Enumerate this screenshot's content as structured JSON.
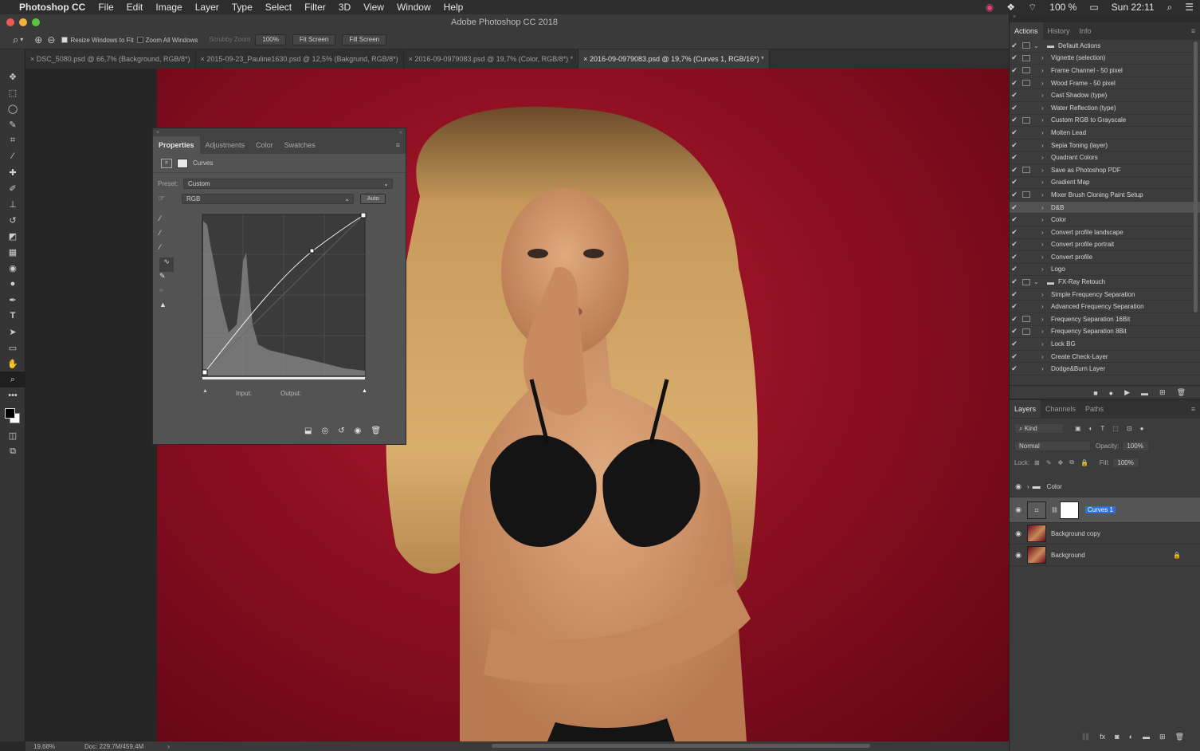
{
  "menubar": {
    "app_name": "Photoshop CC",
    "items": [
      "File",
      "Edit",
      "Image",
      "Layer",
      "Type",
      "Select",
      "Filter",
      "3D",
      "View",
      "Window",
      "Help"
    ],
    "battery": "100 %",
    "clock": "Sun 22:11"
  },
  "window": {
    "title": "Adobe Photoshop CC 2018"
  },
  "options": {
    "resize_windows": "Resize Windows to Fit",
    "zoom_all": "Zoom All Windows",
    "scrubby_zoom": "Scrubby Zoom",
    "zoom_value": "100%",
    "fit_screen": "Fit Screen",
    "fill_screen": "Fill Screen"
  },
  "tabs": [
    "DSC_5080.psd @ 66,7% (Background, RGB/8*)",
    "2015-09-23_Pauline1630.psd @ 12,5% (Bakgrund, RGB/8*)",
    "2016-09-0979083.psd @ 19,7% (Color, RGB/8*) *",
    "2016-09-0979083.psd @ 19,7% (Curves 1, RGB/16*) *"
  ],
  "status": {
    "zoom": "19,68%",
    "doc": "Doc: 229,7M/459,4M"
  },
  "properties": {
    "tabs": [
      "Properties",
      "Adjustments",
      "Color",
      "Swatches"
    ],
    "header": "Curves",
    "preset_label": "Preset:",
    "preset_value": "Custom",
    "channel": "RGB",
    "auto": "Auto",
    "input_label": "Input:",
    "output_label": "Output:"
  },
  "actions": {
    "tabs": [
      "Actions",
      "History",
      "Info"
    ],
    "rows": [
      {
        "label": "Default Actions",
        "folder": true,
        "dialog": true
      },
      {
        "label": "Vignette (selection)",
        "dialog": true
      },
      {
        "label": "Frame Channel - 50 pixel",
        "dialog": true
      },
      {
        "label": "Wood Frame - 50 pixel",
        "dialog": true
      },
      {
        "label": "Cast Shadow (type)",
        "dialog": false
      },
      {
        "label": "Water Reflection (type)",
        "dialog": false
      },
      {
        "label": "Custom RGB to Grayscale",
        "dialog": true
      },
      {
        "label": "Molten Lead",
        "dialog": false
      },
      {
        "label": "Sepia Toning (layer)",
        "dialog": false
      },
      {
        "label": "Quadrant Colors",
        "dialog": false
      },
      {
        "label": "Save as Photoshop PDF",
        "dialog": true
      },
      {
        "label": "Gradient Map",
        "dialog": false
      },
      {
        "label": "Mixer Brush Cloning Paint Setup",
        "dialog": true
      },
      {
        "label": "D&B",
        "dialog": false,
        "selected": true
      },
      {
        "label": "Color",
        "dialog": false
      },
      {
        "label": "Convert profile landscape",
        "dialog": false
      },
      {
        "label": "Convert profile portrait",
        "dialog": false
      },
      {
        "label": "Convert profile",
        "dialog": false
      },
      {
        "label": "Logo",
        "dialog": false
      },
      {
        "label": "FX-Ray Retouch",
        "folder": true,
        "dialog": true
      },
      {
        "label": "Simple Frequency Separation",
        "dialog": false
      },
      {
        "label": "Advanced Frequency Separation",
        "dialog": false
      },
      {
        "label": "Frequency Separation 16Bit",
        "dialog": true
      },
      {
        "label": "Frequency Separation 8Bit",
        "dialog": true
      },
      {
        "label": "Lock BG",
        "dialog": false
      },
      {
        "label": "Create Check-Layer",
        "dialog": false
      },
      {
        "label": "Dodge&Burn Layer",
        "dialog": false
      }
    ]
  },
  "layers": {
    "tabs": [
      "Layers",
      "Channels",
      "Paths"
    ],
    "kind": "Kind",
    "blend_mode": "Normal",
    "opacity_label": "Opacity:",
    "opacity_value": "100%",
    "lock_label": "Lock:",
    "fill_label": "Fill:",
    "fill_value": "100%",
    "items": [
      {
        "name": "Color",
        "type": "group"
      },
      {
        "name": "Curves 1",
        "type": "adjustment",
        "editing": true
      },
      {
        "name": "Background copy",
        "type": "image"
      },
      {
        "name": "Background",
        "type": "image",
        "locked": true
      }
    ]
  },
  "colors": {
    "accent": "#2f6fd6",
    "backdrop": "#9e1228"
  }
}
